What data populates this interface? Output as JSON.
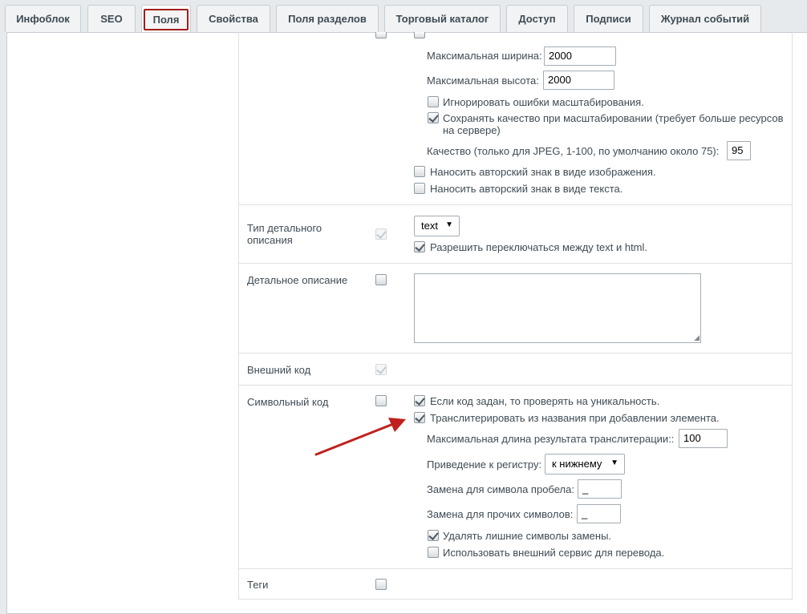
{
  "tabs": [
    {
      "label": "Инфоблок"
    },
    {
      "label": "SEO"
    },
    {
      "label": "Поля"
    },
    {
      "label": "Свойства"
    },
    {
      "label": "Поля разделов"
    },
    {
      "label": "Торговый каталог"
    },
    {
      "label": "Доступ"
    },
    {
      "label": "Подписи"
    },
    {
      "label": "Журнал событий"
    }
  ],
  "image_settings": {
    "max_width_label": "Максимальная ширина:",
    "max_width_value": "2000",
    "max_height_label": "Максимальная высота:",
    "max_height_value": "2000",
    "ignore_errors_label": "Игнорировать ошибки масштабирования.",
    "keep_quality_label_1": "Сохранять качество при масштабировании (требует больше ресурсов",
    "keep_quality_label_2": "на сервере)",
    "quality_label": "Качество (только для JPEG, 1-100, по умолчанию около 75):",
    "quality_value": "95",
    "watermark_image_label": "Наносить авторский знак в виде изображения.",
    "watermark_text_label": "Наносить авторский знак в виде текста."
  },
  "detail_type": {
    "label_1": "Тип детального",
    "label_2": "описания",
    "select_value": "text",
    "allow_switch_label": "Разрешить переключаться между text и html."
  },
  "detail_text": {
    "label": "Детальное описание"
  },
  "external_code": {
    "label": "Внешний код"
  },
  "symbolic_code": {
    "label": "Символьный код",
    "check_unique_label": "Если код задан, то проверять на уникальность.",
    "transliterate_label": "Транслитерировать из названия при добавлении элемента.",
    "max_len_label": "Максимальная длина результата транслитерации::",
    "max_len_value": "100",
    "case_label": "Приведение к регистру:",
    "case_value": "к нижнему",
    "space_repl_label": "Замена для символа пробела:",
    "space_repl_value": "_",
    "other_repl_label": "Замена для прочих символов:",
    "other_repl_value": "_",
    "remove_extra_label": "Удалять лишние символы замены.",
    "external_service_label": "Использовать внешний сервис для перевода."
  },
  "tags": {
    "label": "Теги"
  },
  "colors": {
    "active_tab_border": "#a11d1d",
    "annotation_arrow": "#c0211d"
  }
}
